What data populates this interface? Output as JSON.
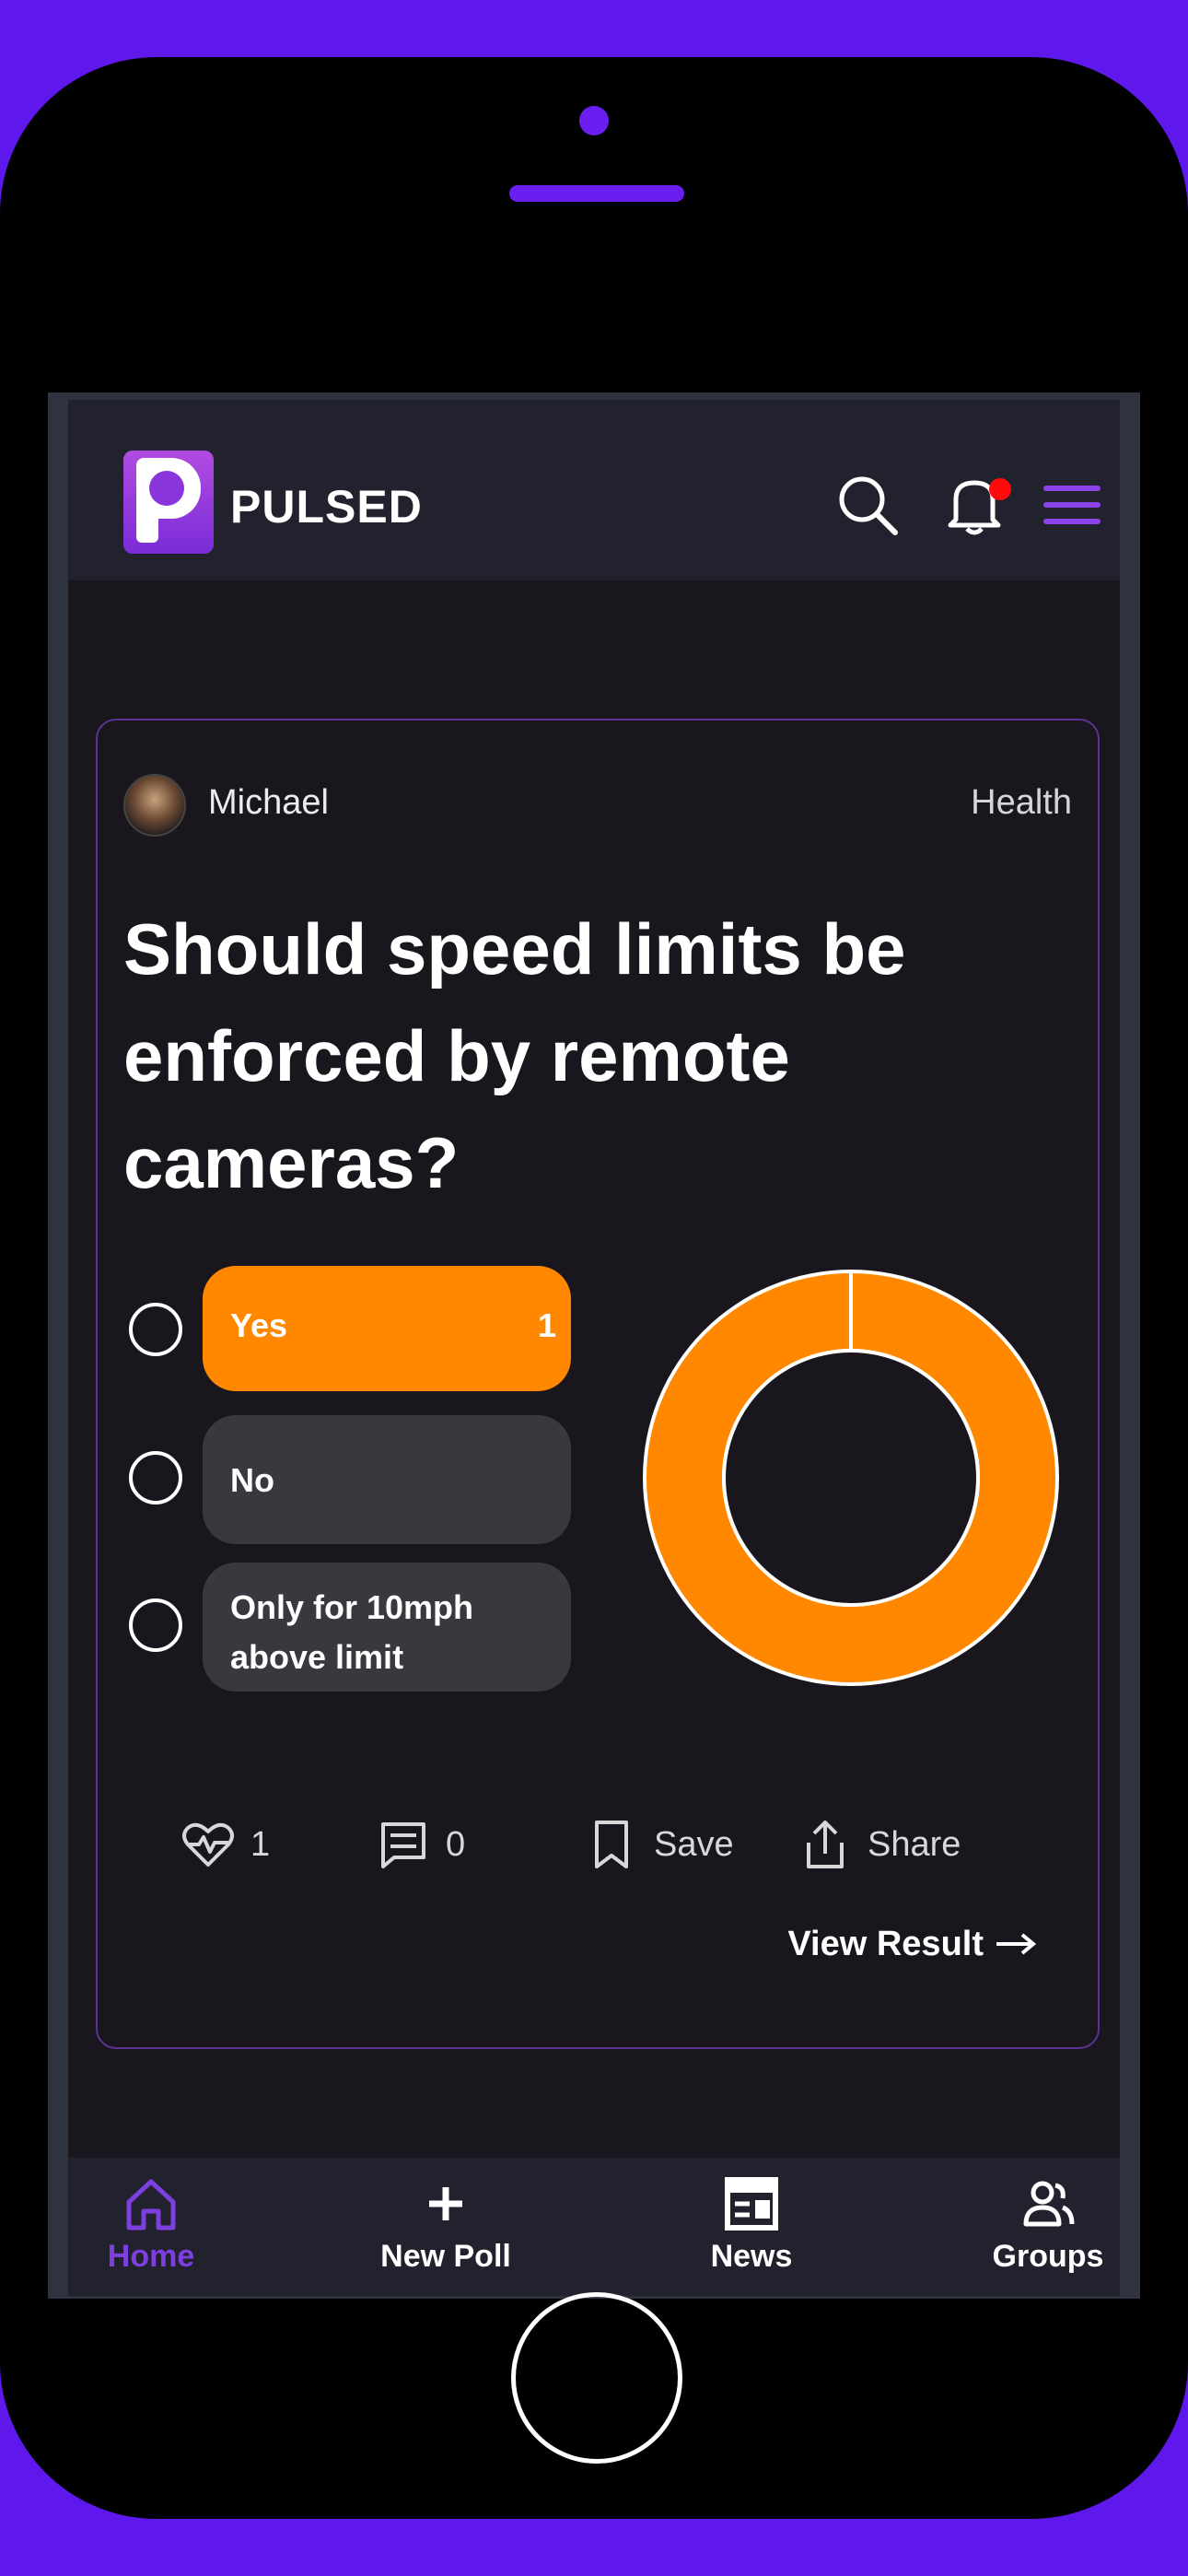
{
  "brand": {
    "name": "PULSED",
    "accent": "#7e3fe0",
    "frame_color": "#5f18ec"
  },
  "header": {
    "icons": [
      "search-icon",
      "bell-icon",
      "menu-icon"
    ],
    "has_notification": true
  },
  "post": {
    "author": "Michael",
    "category": "Health",
    "question": "Should speed limits be enforced by remote cameras?",
    "options": [
      {
        "label": "Yes",
        "votes": "1",
        "color": "#ff8800",
        "selected": true
      },
      {
        "label": "No",
        "votes": "",
        "color": "#3a383f",
        "selected": false
      },
      {
        "label": "Only for 10mph above limit",
        "votes": "",
        "color": "#3a383f",
        "selected": false
      }
    ],
    "chart_data": {
      "type": "pie",
      "categories": [
        "Yes",
        "No",
        "Only for 10mph above limit"
      ],
      "values": [
        1,
        0,
        0
      ],
      "colors": [
        "#ff8800",
        "#3a383f",
        "#3a383f"
      ]
    },
    "actions": {
      "likes": "1",
      "comments": "0",
      "save_label": "Save",
      "share_label": "Share"
    },
    "view_result_label": "View Result"
  },
  "bottom_nav": {
    "items": [
      {
        "label": "Home",
        "icon": "home-icon",
        "active": true
      },
      {
        "label": "New Poll",
        "icon": "plus-icon",
        "active": false
      },
      {
        "label": "News",
        "icon": "news-icon",
        "active": false
      },
      {
        "label": "Groups",
        "icon": "groups-icon",
        "active": false
      }
    ]
  }
}
